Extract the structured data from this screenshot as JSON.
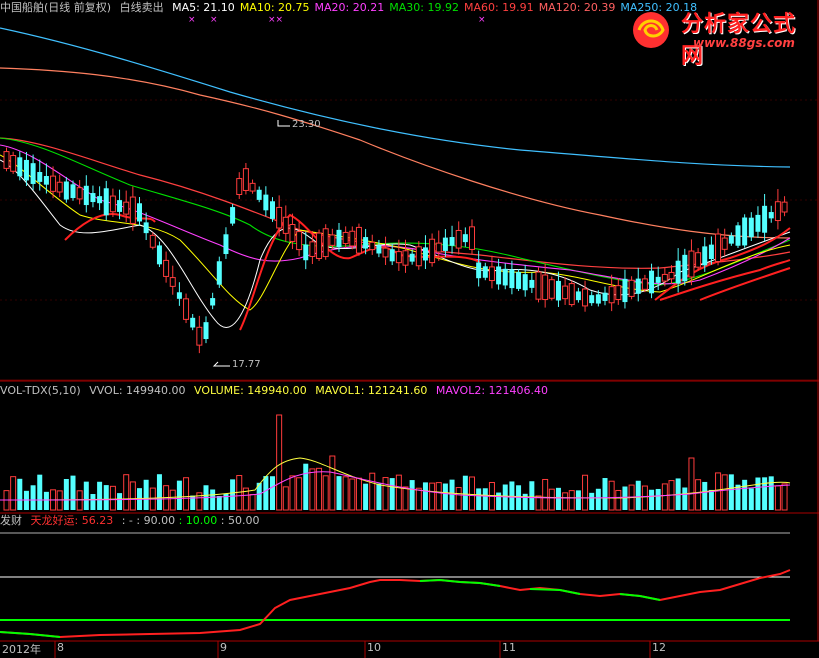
{
  "header": {
    "title": "中国船舶(日线 前复权)",
    "signal": "白线卖出",
    "ma": [
      {
        "label": "MA5:",
        "value": "21.10",
        "color": "#ffffff"
      },
      {
        "label": "MA10:",
        "value": "20.75",
        "color": "#ffff00"
      },
      {
        "label": "MA20:",
        "value": "20.21",
        "color": "#ff40ff"
      },
      {
        "label": "MA30:",
        "value": "19.92",
        "color": "#00e000"
      },
      {
        "label": "MA60:",
        "value": "19.91",
        "color": "#ff4040"
      },
      {
        "label": "MA120:",
        "value": "20.39",
        "color": "#ff6060"
      },
      {
        "label": "MA250:",
        "value": "20.18",
        "color": "#40c0ff"
      }
    ]
  },
  "price_labels": {
    "high": "23.30",
    "low": "17.77"
  },
  "volume_header": {
    "name": "VOL-TDX(5,10)",
    "vvol": "VVOL: 149940.00",
    "volume": "VOLUME: 149940.00",
    "mavol1": "MAVOL1: 121241.60",
    "mavol2": "MAVOL2: 121406.40"
  },
  "indicator_header": {
    "name": "发财",
    "series": "天龙好运: 56.23",
    "ref1": ": - : 90.00",
    "ref2": ": 10.00",
    "ref3": ": 50.00"
  },
  "date_axis": [
    "2012年",
    "8",
    "9",
    "10",
    "11",
    "12"
  ],
  "logo": {
    "title": "分析家公式网",
    "url": "www.88gs.com"
  },
  "colors": {
    "up": "#ff3c3c",
    "down": "#54ffff",
    "ma5": "#ffffff",
    "ma10": "#ffff00",
    "ma20": "#ff40ff",
    "ma30": "#00e000",
    "ma60": "#ff4040",
    "ma120": "#ff8060",
    "ma250": "#40c0ff"
  }
}
